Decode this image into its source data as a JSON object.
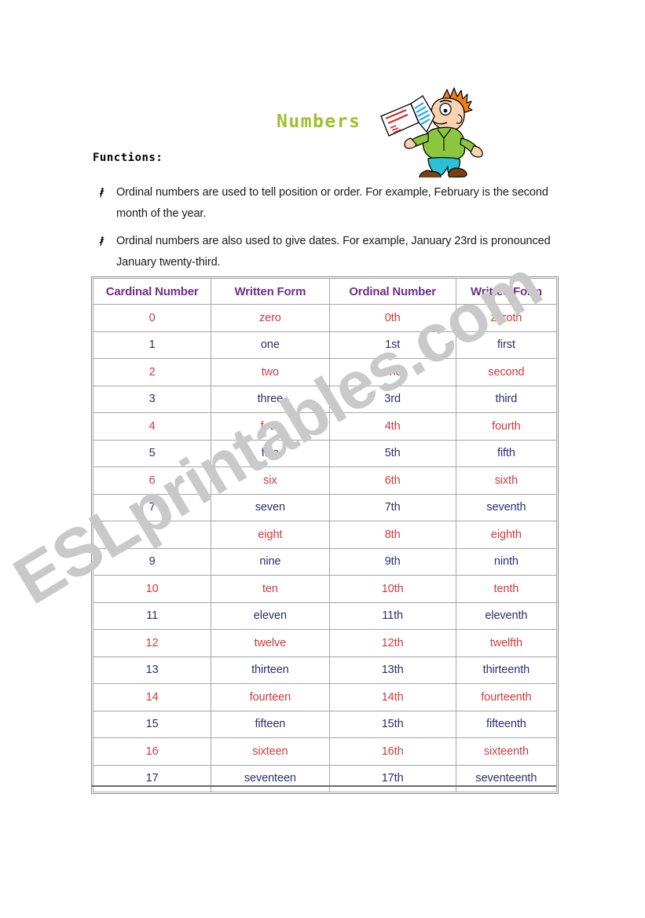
{
  "document": {
    "title": "Numbers",
    "functions_label": "Functions:",
    "watermark": "ESLprintables.com",
    "bullet_glyph": "pen-nib-bullet",
    "bullets": [
      "Ordinal numbers are used to tell position or order. For example, February is the second month of the year.",
      "Ordinal numbers are also used to give dates. For example, January 23rd is pronounced January twenty-third."
    ]
  },
  "colors": {
    "title": "#9fc02c",
    "header_text": "#6e2f8e",
    "row_red": "#d03a3a",
    "row_blue": "#2b2f6b",
    "border": "#a6a6a6",
    "watermark": "#c9c9c9"
  },
  "clipart": {
    "name": "boy-reading-book",
    "hair": "#f07f1a",
    "skin": "#f7d3b0",
    "shirt": "#8cc63f",
    "pants": "#29c2d4",
    "shoes": "#7b3f12",
    "book_page": "#ffffff",
    "book_lines_blue": "#29abe2",
    "book_lines_red": "#d22b2b"
  },
  "table": {
    "headers": [
      "Cardinal Number",
      "Written Form",
      "Ordinal Number",
      "Written Form"
    ],
    "rows": [
      {
        "cardinal": "0",
        "cardinal_word": "zero",
        "ordinal": "0th",
        "ordinal_word": "zeroth",
        "color": "red"
      },
      {
        "cardinal": "1",
        "cardinal_word": "one",
        "ordinal": "1st",
        "ordinal_word": "first",
        "color": "blue"
      },
      {
        "cardinal": "2",
        "cardinal_word": "two",
        "ordinal": "2nd",
        "ordinal_word": "second",
        "color": "red"
      },
      {
        "cardinal": "3",
        "cardinal_word": "three",
        "ordinal": "3rd",
        "ordinal_word": "third",
        "color": "blue"
      },
      {
        "cardinal": "4",
        "cardinal_word": "four",
        "ordinal": "4th",
        "ordinal_word": "fourth",
        "color": "red"
      },
      {
        "cardinal": "5",
        "cardinal_word": "five",
        "ordinal": "5th",
        "ordinal_word": "fifth",
        "color": "blue"
      },
      {
        "cardinal": "6",
        "cardinal_word": "six",
        "ordinal": "6th",
        "ordinal_word": "sixth",
        "color": "red"
      },
      {
        "cardinal": "7",
        "cardinal_word": "seven",
        "ordinal": "7th",
        "ordinal_word": "seventh",
        "color": "blue"
      },
      {
        "cardinal": "8",
        "cardinal_word": "eight",
        "ordinal": "8th",
        "ordinal_word": "eighth",
        "color": "red"
      },
      {
        "cardinal": "9",
        "cardinal_word": "nine",
        "ordinal": "9th",
        "ordinal_word": "ninth",
        "color": "blue"
      },
      {
        "cardinal": "10",
        "cardinal_word": "ten",
        "ordinal": "10th",
        "ordinal_word": "tenth",
        "color": "red"
      },
      {
        "cardinal": "11",
        "cardinal_word": "eleven",
        "ordinal": "11th",
        "ordinal_word": "eleventh",
        "color": "blue"
      },
      {
        "cardinal": "12",
        "cardinal_word": "twelve",
        "ordinal": "12th",
        "ordinal_word": "twelfth",
        "color": "red"
      },
      {
        "cardinal": "13",
        "cardinal_word": "thirteen",
        "ordinal": "13th",
        "ordinal_word": "thirteenth",
        "color": "blue"
      },
      {
        "cardinal": "14",
        "cardinal_word": "fourteen",
        "ordinal": "14th",
        "ordinal_word": "fourteenth",
        "color": "red"
      },
      {
        "cardinal": "15",
        "cardinal_word": "fifteen",
        "ordinal": "15th",
        "ordinal_word": "fifteenth",
        "color": "blue"
      },
      {
        "cardinal": "16",
        "cardinal_word": "sixteen",
        "ordinal": "16th",
        "ordinal_word": "sixteenth",
        "color": "red"
      },
      {
        "cardinal": "17",
        "cardinal_word": "seventeen",
        "ordinal": "17th",
        "ordinal_word": "seventeenth",
        "color": "blue"
      }
    ]
  }
}
